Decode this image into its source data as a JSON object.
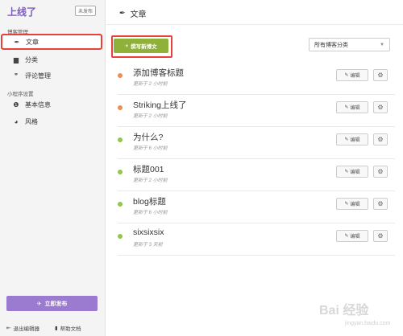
{
  "sidebar": {
    "site_title": "上线了",
    "badge": "未发布",
    "section_blog": "博客管理",
    "items_blog": [
      {
        "label": "文章",
        "icon": "feather-icon",
        "glyph": "✒"
      },
      {
        "label": "分类",
        "icon": "folder-icon",
        "glyph": "▇"
      },
      {
        "label": "评论管理",
        "icon": "comments-icon",
        "glyph": "💬"
      }
    ],
    "section_app": "小程序设置",
    "items_app": [
      {
        "label": "基本信息",
        "icon": "info-icon",
        "glyph": "❶"
      },
      {
        "label": "风格",
        "icon": "palette-icon",
        "glyph": "◕"
      }
    ],
    "publish_label": "立即发布",
    "exit_label": "退出编辑器",
    "help_label": "帮助文档"
  },
  "main": {
    "header_title": "文章",
    "new_post_label": "撰写新博文",
    "category_select": "所有博客分类",
    "edit_label": "编辑",
    "posts": [
      {
        "title": "添加博客标题",
        "time": "更新于 2 小时前",
        "status": "orange"
      },
      {
        "title": "Striking上线了",
        "time": "更新于 2 小时前",
        "status": "orange"
      },
      {
        "title": "为什么?",
        "time": "更新于 6 小时前",
        "status": "green"
      },
      {
        "title": "标题001",
        "time": "更新于 2 小时前",
        "status": "green"
      },
      {
        "title": "blog标题",
        "time": "更新于 6 小时前",
        "status": "green"
      },
      {
        "title": "sixsixsix",
        "time": "更新于 3 天前",
        "status": "green"
      }
    ]
  },
  "watermark": {
    "text": "Bai 经验",
    "sub": "jingyan.baidu.com"
  },
  "colors": {
    "accent": "#7c5bbf",
    "publish": "#9a7bd0",
    "new_post": "#8fb13a",
    "highlight": "#e8413b",
    "draft_dot": "#ee8c55",
    "published_dot": "#8ec74a"
  }
}
